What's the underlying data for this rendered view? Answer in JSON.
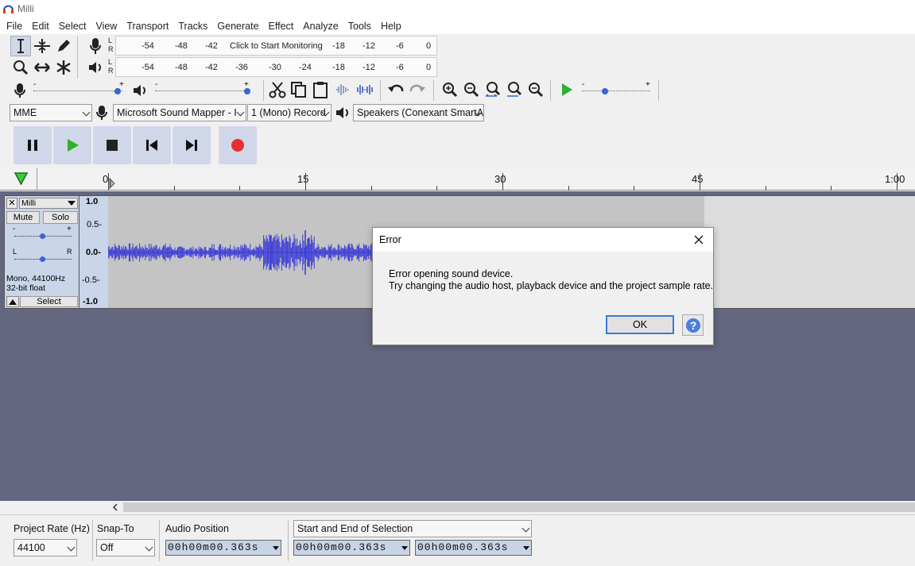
{
  "window": {
    "title": "Milli"
  },
  "menu": [
    "File",
    "Edit",
    "Select",
    "View",
    "Transport",
    "Tracks",
    "Generate",
    "Effect",
    "Analyze",
    "Tools",
    "Help"
  ],
  "meters": {
    "record": {
      "ticks": [
        "-54",
        "-48",
        "-42",
        "-18",
        "-12",
        "-6",
        "0"
      ],
      "monitor_label": "Click to Start Monitoring",
      "lr": [
        "L",
        "R"
      ]
    },
    "playback": {
      "ticks": [
        "-54",
        "-48",
        "-42",
        "-36",
        "-30",
        "-24",
        "-18",
        "-12",
        "-6",
        "0"
      ],
      "lr": [
        "L",
        "R"
      ]
    }
  },
  "mixer": {
    "minus": "-",
    "plus": "+"
  },
  "devices": {
    "host": "MME",
    "record_device": "Microsoft Sound Mapper - I",
    "channels": "1 (Mono) Record",
    "playback_device": "Speakers (Conexant SmartA"
  },
  "ruler": {
    "labels": [
      "0",
      "15",
      "30",
      "45",
      "1:00"
    ]
  },
  "track": {
    "name": "Milli",
    "mute": "Mute",
    "solo": "Solo",
    "gain_minus": "-",
    "gain_plus": "+",
    "pan_l": "L",
    "pan_r": "R",
    "info1": "Mono, 44100Hz",
    "info2": "32-bit float",
    "select": "Select",
    "scale": [
      "1.0",
      "0.5-",
      "0.0-",
      "-0.5-",
      "-1.0"
    ]
  },
  "dialog": {
    "title": "Error",
    "line1": "Error opening sound device.",
    "line2": "Try changing the audio host, playback device and the project sample rate.",
    "ok": "OK",
    "help": "?"
  },
  "bottom": {
    "rate_label": "Project Rate (Hz)",
    "rate_value": "44100",
    "snap_label": "Snap-To",
    "snap_value": "Off",
    "audio_pos_label": "Audio Position",
    "selection_mode": "Start and End of Selection",
    "time1": "00h00m00.363s",
    "time2": "00h00m00.363s",
    "time3": "00h00m00.363s"
  },
  "colors": {
    "accent": "#3a7bd5",
    "waveform": "#3a3ad6",
    "track_bg": "#63677f",
    "record_red": "#e23030",
    "play_green": "#2fb02f"
  }
}
